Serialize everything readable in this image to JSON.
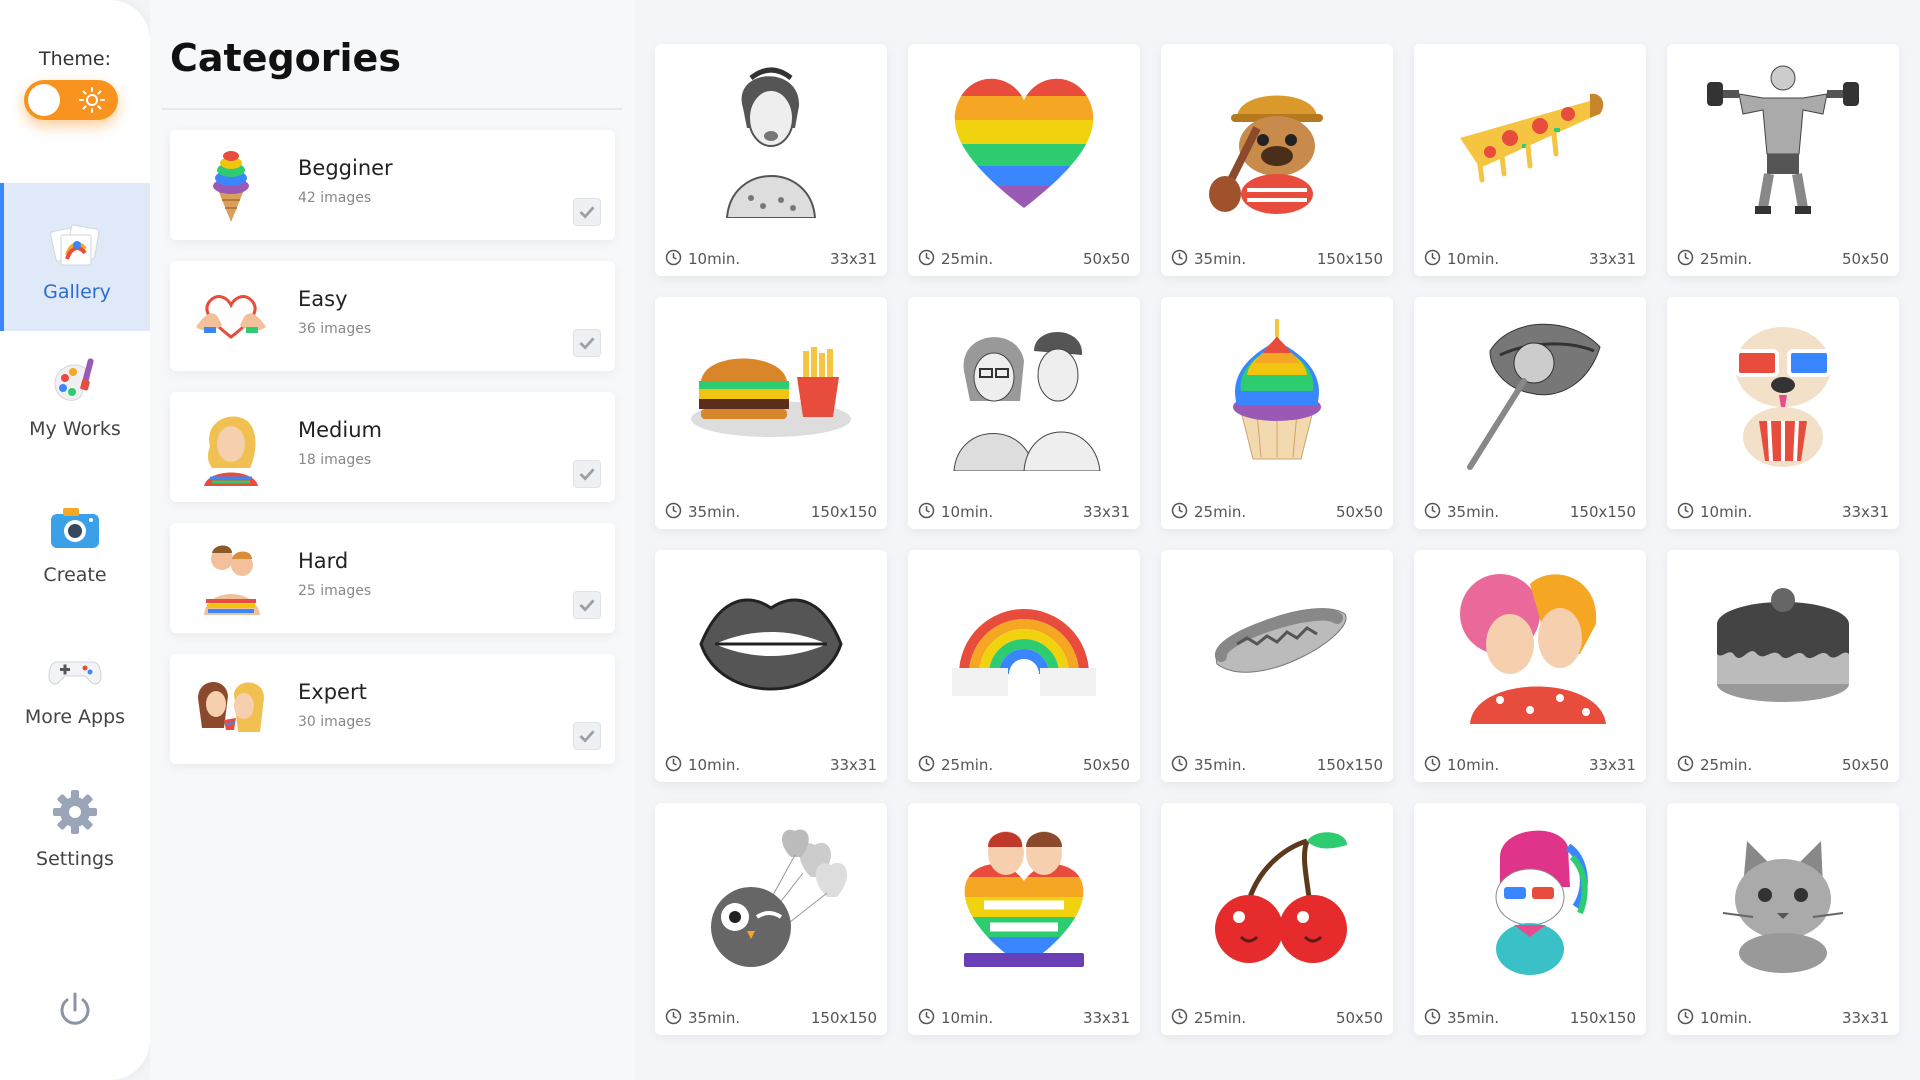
{
  "sidebar": {
    "theme_label": "Theme:",
    "nav": [
      {
        "label": "Gallery",
        "icon": "gallery-icon",
        "active": true
      },
      {
        "label": "My Works",
        "icon": "palette-icon"
      },
      {
        "label": "Create",
        "icon": "camera-icon"
      },
      {
        "label": "More Apps",
        "icon": "gamepad-icon"
      },
      {
        "label": "Settings",
        "icon": "gear-icon"
      }
    ],
    "power_icon": "power-icon",
    "theme_toggle": {
      "state": "on",
      "icon": "sun-icon",
      "color": "#f7931e"
    }
  },
  "categories": {
    "title": "Categories",
    "items": [
      {
        "name": "Begginer",
        "count": "42 images",
        "icon": "rainbow-icecream-icon"
      },
      {
        "name": "Easy",
        "count": "36 images",
        "icon": "heart-hands-icon"
      },
      {
        "name": "Medium",
        "count": "18 images",
        "icon": "woman-portrait-icon"
      },
      {
        "name": "Hard",
        "count": "25 images",
        "icon": "couple-hug-icon"
      },
      {
        "name": "Expert",
        "count": "30 images",
        "icon": "couple-kiss-icon"
      }
    ]
  },
  "gallery": {
    "tiles": [
      {
        "art": "pinup-woman-art",
        "time": "10min.",
        "size": "33x31"
      },
      {
        "art": "rainbow-heart-art",
        "time": "25min.",
        "size": "50x50"
      },
      {
        "art": "pug-guitar-art",
        "time": "35min.",
        "size": "150x150"
      },
      {
        "art": "pizza-slice-art",
        "time": "10min.",
        "size": "33x31"
      },
      {
        "art": "bodybuilder-art",
        "time": "25min.",
        "size": "50x50"
      },
      {
        "art": "burger-fries-art",
        "time": "35min.",
        "size": "150x150"
      },
      {
        "art": "retro-couple-art",
        "time": "10min.",
        "size": "33x31"
      },
      {
        "art": "rainbow-cupcake-art",
        "time": "25min.",
        "size": "50x50"
      },
      {
        "art": "lips-lollipop-art",
        "time": "35min.",
        "size": "150x150"
      },
      {
        "art": "pug-3d-glasses-art",
        "time": "10min.",
        "size": "33x31"
      },
      {
        "art": "lips-art",
        "time": "10min.",
        "size": "33x31"
      },
      {
        "art": "rainbow-clouds-art",
        "time": "25min.",
        "size": "50x50"
      },
      {
        "art": "hotdog-art",
        "time": "35min.",
        "size": "150x150"
      },
      {
        "art": "women-kiss-art",
        "time": "10min.",
        "size": "33x31"
      },
      {
        "art": "cake-art",
        "time": "25min.",
        "size": "50x50"
      },
      {
        "art": "owl-balloons-art",
        "time": "35min.",
        "size": "150x150"
      },
      {
        "art": "love-wins-art",
        "time": "10min.",
        "size": "33x31"
      },
      {
        "art": "cherries-art",
        "time": "25min.",
        "size": "50x50"
      },
      {
        "art": "unicorn-art",
        "time": "35min.",
        "size": "150x150"
      },
      {
        "art": "kitten-art",
        "time": "10min.",
        "size": "33x31"
      }
    ]
  }
}
